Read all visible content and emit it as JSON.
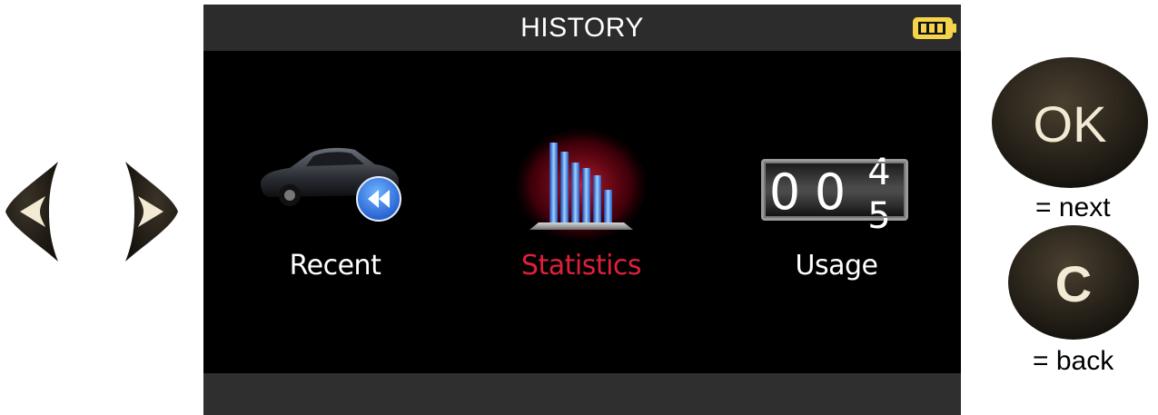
{
  "screen": {
    "title": "HISTORY",
    "battery_icon": "battery-full-icon",
    "menu_items": [
      {
        "label": "Recent",
        "icon": "car-rewind-icon",
        "selected": false
      },
      {
        "label": "Statistics",
        "icon": "bar-chart-icon",
        "selected": true
      },
      {
        "label": "Usage",
        "icon": "odometer-counter-icon",
        "selected": false
      }
    ],
    "counter": {
      "digits": [
        "0",
        "0"
      ],
      "rolling_top": "4",
      "rolling_bottom": "5"
    }
  },
  "controls": {
    "left_arrow_icon": "arrow-left-icon",
    "right_arrow_icon": "arrow-right-icon",
    "ok_button_label": "OK",
    "ok_hint": "= next",
    "c_button_label": "C",
    "c_hint": "= back"
  },
  "colors": {
    "screen_bg": "#000000",
    "title_bar_bg": "#2c2c2c",
    "selected_label": "#e0203a",
    "battery": "#f5d44a",
    "button_body": "#2b2417"
  }
}
